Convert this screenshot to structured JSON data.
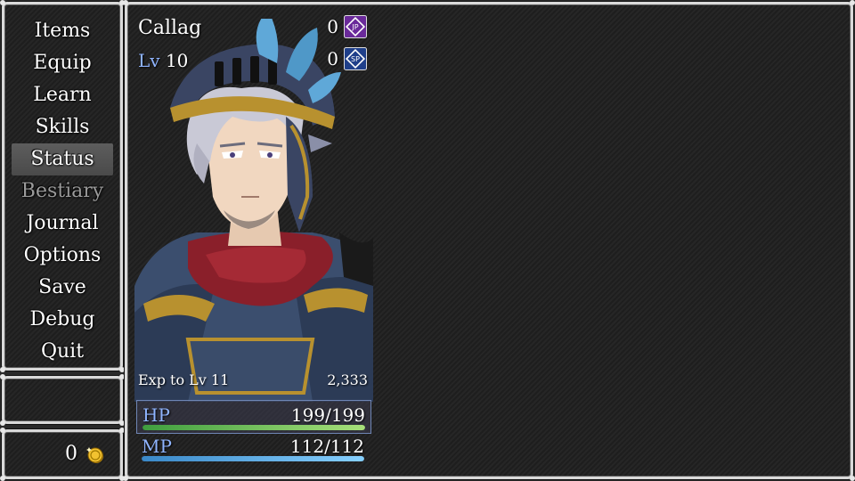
{
  "menu": {
    "items": [
      {
        "label": "Items",
        "state": "normal"
      },
      {
        "label": "Equip",
        "state": "normal"
      },
      {
        "label": "Learn",
        "state": "normal"
      },
      {
        "label": "Skills",
        "state": "normal"
      },
      {
        "label": "Status",
        "state": "selected"
      },
      {
        "label": "Bestiary",
        "state": "disabled"
      },
      {
        "label": "Journal",
        "state": "normal"
      },
      {
        "label": "Options",
        "state": "normal"
      },
      {
        "label": "Save",
        "state": "normal"
      },
      {
        "label": "Debug",
        "state": "normal"
      },
      {
        "label": "Quit",
        "state": "normal"
      }
    ]
  },
  "gold": {
    "value": "0",
    "icon": "gold-coin-icon"
  },
  "actor": {
    "name": "Callag",
    "level_label": "Lv",
    "level": "10",
    "jp": {
      "value": "0",
      "icon": "jp-icon",
      "text": "JP",
      "color": "#6a2a9a"
    },
    "sp": {
      "value": "0",
      "icon": "sp-icon",
      "text": "SP",
      "color": "#1f3f8a"
    },
    "exp_label": "Exp to Lv 11",
    "exp_value": "2,333",
    "hp": {
      "label": "HP",
      "value": "199/199",
      "ratio": 1.0,
      "color": "#6fca5a"
    },
    "mp": {
      "label": "MP",
      "value": "112/112",
      "ratio": 1.0,
      "color": "#5ab0e8"
    }
  }
}
